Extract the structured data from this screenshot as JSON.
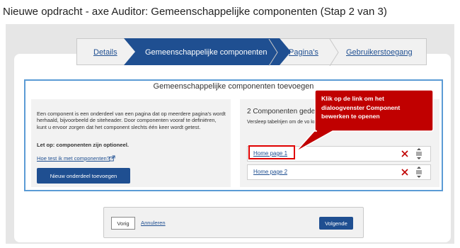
{
  "window": {
    "title": "Nieuwe opdracht - axe Auditor: Gemeenschappelijke componenten (Stap 2 van 3)"
  },
  "stepper": {
    "steps": [
      {
        "label": "Details",
        "state": "link"
      },
      {
        "label": "Gemeenschappelijke componenten",
        "state": "active"
      },
      {
        "label": "Pagina's",
        "state": "link"
      },
      {
        "label": "Gebruikerstoegang",
        "state": "link"
      }
    ],
    "active_color": "#1f4f91"
  },
  "components_section": {
    "title": "Gemeenschappelijke componenten toevoegen",
    "description": "Een component is een onderdeel van een pagina dat op meerdere pagina's wordt herhaald, bijvoorbeeld de siteheader. Door componenten vooraf te definiëren, kunt u ervoor zorgen dat het component slechts één keer wordt getest.",
    "note": "Let op: componenten zijn optioneel.",
    "help_link": "Hoe test ik met componenten?",
    "new_button": "Nieuw onderdeel toevoegen"
  },
  "component_list": {
    "count_label": "2 Componenten gede",
    "sort_help": "Versleep tabelrijen om de vo                                  kunnen de verplaatsingsknop se                                  met de pijltjestoetsen.",
    "items": [
      {
        "label": "Home page 1"
      },
      {
        "label": "Home page 2"
      }
    ]
  },
  "callout": {
    "text": "Klik op de link om het dialoogvenster Component bewerken te openen",
    "color": "#c00000"
  },
  "footer": {
    "prev_button": "Vorig",
    "cancel_link": "Annuleren",
    "next_button": "Volgende"
  },
  "icons": {
    "external": "external-link-icon",
    "delete": "delete-x-icon",
    "drag": "drag-handle-icon"
  }
}
